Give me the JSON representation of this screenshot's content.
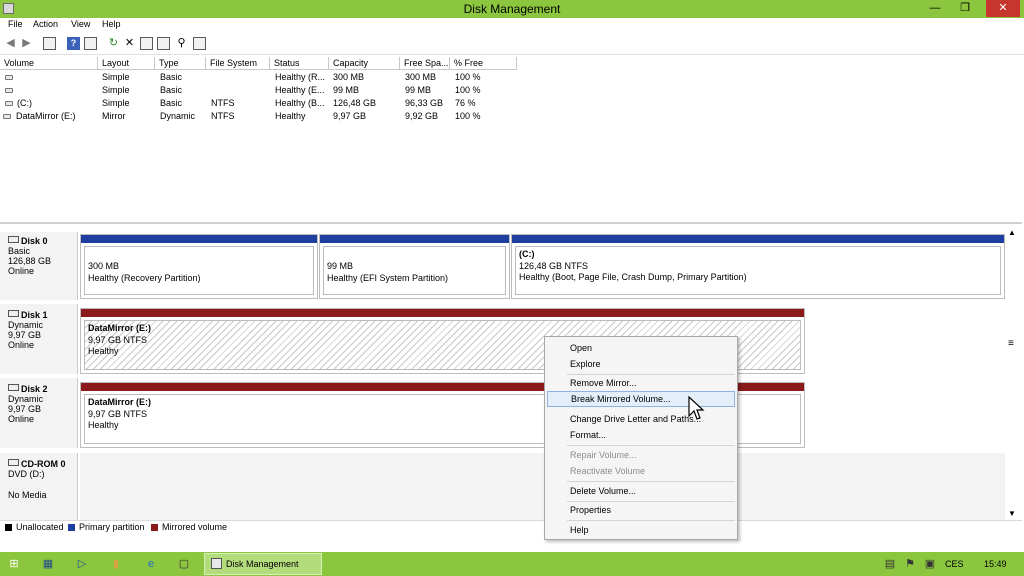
{
  "window": {
    "title": "Disk Management"
  },
  "menu": {
    "items": [
      "File",
      "Action",
      "View",
      "Help"
    ]
  },
  "volume_table": {
    "columns": [
      "Volume",
      "Layout",
      "Type",
      "File System",
      "Status",
      "Capacity",
      "Free Spa...",
      "% Free"
    ],
    "rows": [
      {
        "volume": "",
        "layout": "Simple",
        "type": "Basic",
        "fs": "",
        "status": "Healthy (R...",
        "capacity": "300 MB",
        "free": "300 MB",
        "pct": "100 %"
      },
      {
        "volume": "",
        "layout": "Simple",
        "type": "Basic",
        "fs": "",
        "status": "Healthy (E...",
        "capacity": "99 MB",
        "free": "99 MB",
        "pct": "100 %"
      },
      {
        "volume": "(C:)",
        "layout": "Simple",
        "type": "Basic",
        "fs": "NTFS",
        "status": "Healthy (B...",
        "capacity": "126,48 GB",
        "free": "96,33 GB",
        "pct": "76 %"
      },
      {
        "volume": "DataMirror (E:)",
        "layout": "Mirror",
        "type": "Dynamic",
        "fs": "NTFS",
        "status": "Healthy",
        "capacity": "9,97 GB",
        "free": "9,92 GB",
        "pct": "100 %"
      }
    ]
  },
  "disks": [
    {
      "name": "Disk 0",
      "type": "Basic",
      "size": "126,88 GB",
      "state": "Online",
      "partitions": [
        {
          "title": "",
          "size": "300 MB",
          "status": "Healthy (Recovery Partition)"
        },
        {
          "title": "",
          "size": "99 MB",
          "status": "Healthy (EFI System Partition)"
        },
        {
          "title": "(C:)",
          "size": "126,48 GB NTFS",
          "status": "Healthy (Boot, Page File, Crash Dump, Primary Partition)"
        }
      ]
    },
    {
      "name": "Disk 1",
      "type": "Dynamic",
      "size": "9,97 GB",
      "state": "Online",
      "partitions": [
        {
          "title": "DataMirror  (E:)",
          "size": "9,97 GB NTFS",
          "status": "Healthy"
        }
      ]
    },
    {
      "name": "Disk 2",
      "type": "Dynamic",
      "size": "9,97 GB",
      "state": "Online",
      "partitions": [
        {
          "title": "DataMirror  (E:)",
          "size": "9,97 GB NTFS",
          "status": "Healthy"
        }
      ]
    },
    {
      "name": "CD-ROM 0",
      "type": "DVD (D:)",
      "size": "",
      "state": "No Media",
      "partitions": []
    }
  ],
  "legend": [
    {
      "label": "Unallocated",
      "color": "#000000"
    },
    {
      "label": "Primary partition",
      "color": "#1f3fa0"
    },
    {
      "label": "Mirrored volume",
      "color": "#8b1a1a"
    }
  ],
  "context_menu": {
    "items": [
      "Open",
      "Explore",
      "Remove Mirror...",
      "Break Mirrored Volume...",
      "Change Drive Letter and Paths...",
      "Format...",
      "Repair Volume...",
      "Reactivate Volume",
      "Delete Volume...",
      "Properties",
      "Help"
    ],
    "highlighted": "Break Mirrored Volume...",
    "disabled": [
      "Repair Volume...",
      "Reactivate Volume"
    ]
  },
  "taskbar": {
    "app_label": "Disk Management",
    "language": "CES",
    "clock": "15:49"
  },
  "colors": {
    "titlebar": "#8cc63f",
    "primary_bar": "#1f3fa0",
    "mirror_bar": "#8b1a1a",
    "close_button": "#c7362c"
  }
}
